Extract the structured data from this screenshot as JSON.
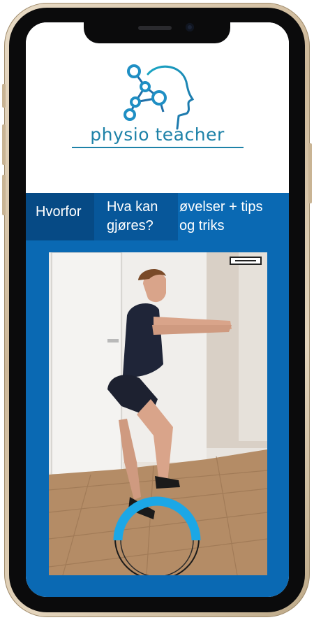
{
  "app": {
    "logo_text": "physio teacher",
    "colors": {
      "brand_blue": "#1e82a8",
      "tab_bar": "#0a69b3",
      "tab_active": "#064a85"
    }
  },
  "tabs": [
    {
      "label": "Hvorfor"
    },
    {
      "label_line1": "Hva kan",
      "label_line2": "gjøres?"
    },
    {
      "label_line1": "øvelser + tips",
      "label_line2": "og triks"
    }
  ],
  "media": {
    "content": "photo of a man doing a squat exercise",
    "progress_ring": {
      "fraction": 0.5,
      "color": "#1ca7e6"
    }
  }
}
